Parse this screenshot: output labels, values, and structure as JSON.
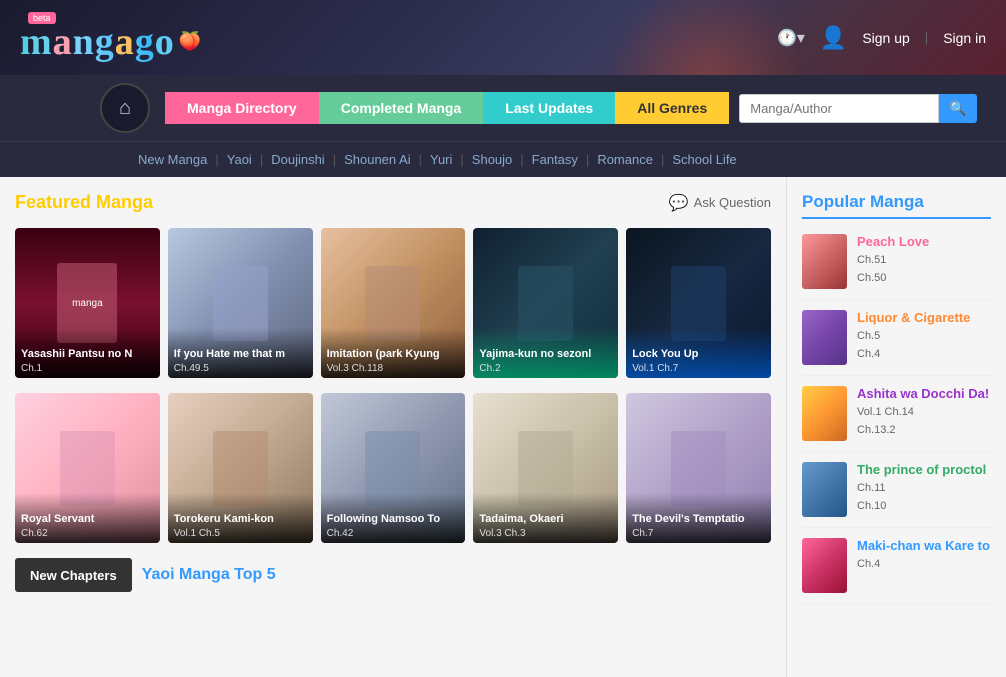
{
  "header": {
    "logo_text": "mangago",
    "logo_beta": "beta",
    "logo_sparkle": "✨",
    "sign_up": "Sign up",
    "sign_in": "Sign in",
    "separator": "|"
  },
  "nav": {
    "home_icon": "⌂",
    "buttons": [
      {
        "label": "Manga Directory",
        "style": "pink"
      },
      {
        "label": "Completed Manga",
        "style": "green"
      },
      {
        "label": "Last Updates",
        "style": "teal"
      },
      {
        "label": "All Genres",
        "style": "yellow"
      }
    ],
    "search_placeholder": "Manga/Author",
    "search_icon": "🔍"
  },
  "sub_nav": {
    "links": [
      "New Manga",
      "Yaoi",
      "Doujinshi",
      "Shounen Ai",
      "Yuri",
      "Shoujo",
      "Fantasy",
      "Romance",
      "School Life"
    ]
  },
  "featured": {
    "title": "Featured Manga",
    "ask_question": "Ask Question",
    "manga_cards": [
      {
        "title": "Yasashii Pantsu no N",
        "chapter": "Ch.1",
        "bg": "bg-dark-red"
      },
      {
        "title": "If you Hate me that m",
        "chapter": "Ch.49.5",
        "bg": "bg-light-blue"
      },
      {
        "title": "Imitation (park Kyung",
        "chapter": "Vol.3 Ch.118",
        "bg": "bg-warm"
      },
      {
        "title": "Yajima-kun no sezonl",
        "chapter": "Ch.2",
        "bg": "bg-teal",
        "overlay": "green"
      },
      {
        "title": "Lock You Up",
        "chapter": "Vol.1 Ch.7",
        "bg": "bg-dark-blue",
        "overlay": "blue"
      },
      {
        "title": "Royal Servant",
        "chapter": "Ch.62",
        "bg": "bg-pink"
      },
      {
        "title": "Torokeru Kami-kon",
        "chapter": "Vol.1 Ch.5",
        "bg": "bg-manga2"
      },
      {
        "title": "Following Namsoo To",
        "chapter": "Ch.42",
        "bg": "bg-manga3"
      },
      {
        "title": "Tadaima, Okaeri",
        "chapter": "Vol.3 Ch.3",
        "bg": "bg-manga4"
      },
      {
        "title": "The Devil's Temptatio",
        "chapter": "Ch.7",
        "bg": "bg-manga5"
      }
    ]
  },
  "bottom": {
    "new_chapters_label": "New Chapters",
    "yaoi_top_label": "Yaoi Manga Top 5"
  },
  "sidebar": {
    "title": "Popular Manga",
    "items": [
      {
        "title": "Peach Love",
        "chapters": [
          "Ch.51",
          "Ch.50"
        ],
        "title_color": "pink",
        "thumb_class": "sidebar-thumb1"
      },
      {
        "title": "Liquor & Cigarette",
        "chapters": [
          "Ch.5",
          "Ch.4"
        ],
        "title_color": "orange",
        "thumb_class": "sidebar-thumb2"
      },
      {
        "title": "Ashita wa Docchi Da!",
        "chapters": [
          "Vol.1 Ch.14",
          "Ch.13.2"
        ],
        "title_color": "purple",
        "thumb_class": "sidebar-thumb3"
      },
      {
        "title": "The prince of proctol",
        "chapters": [
          "Ch.11",
          "Ch.10"
        ],
        "title_color": "green",
        "thumb_class": "sidebar-thumb4"
      },
      {
        "title": "Maki-chan wa Kare to",
        "chapters": [
          "Ch.4"
        ],
        "title_color": "blue",
        "thumb_class": "sidebar-thumb5"
      }
    ]
  }
}
